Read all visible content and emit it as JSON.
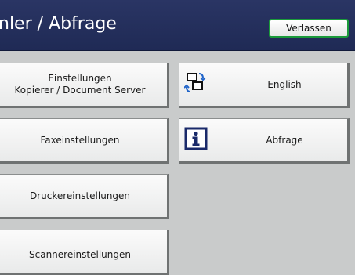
{
  "header": {
    "title": "nler / Abfrage",
    "exit_label": "Verlassen"
  },
  "left_buttons": [
    {
      "line1": "Einstellungen",
      "line2": "Kopierer / Document Server"
    },
    {
      "label": "Faxeinstellungen"
    },
    {
      "label": "Druckereinstellungen"
    },
    {
      "label": "Scannereinstellungen"
    }
  ],
  "right_buttons": [
    {
      "label": "English",
      "icon": "language-switch-icon"
    },
    {
      "label": "Abfrage",
      "icon": "info-icon"
    }
  ],
  "colors": {
    "header_bg": "#22305c",
    "exit_border": "#1a9a3a",
    "background": "#c9cbcb"
  }
}
